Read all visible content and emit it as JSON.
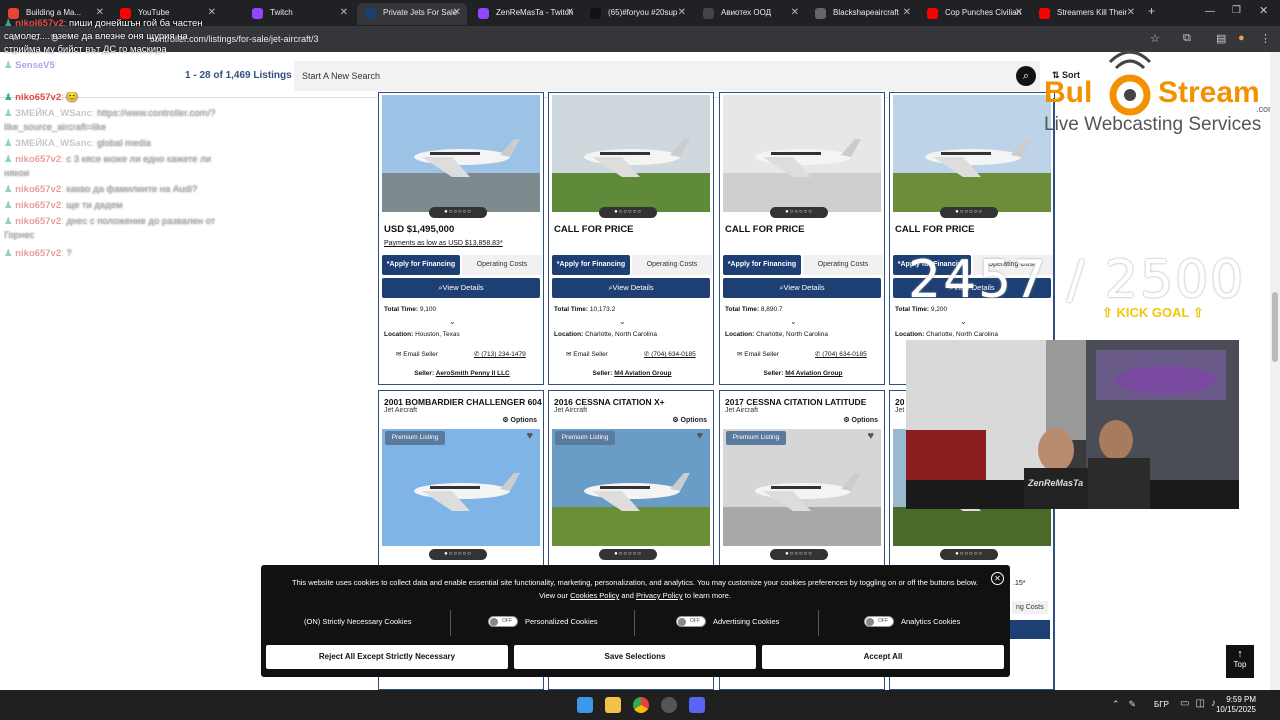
{
  "browser": {
    "tabs": [
      {
        "label": "Building a Ma...",
        "color": "#ea4335"
      },
      {
        "label": "YouTube",
        "color": "#ff0000"
      },
      {
        "label": "Twitch",
        "color": "#9146ff"
      },
      {
        "label": "Private Jets For Sale",
        "color": "#1e3f73"
      },
      {
        "label": "ZenReMasTa - Twitch",
        "color": "#9146ff"
      },
      {
        "label": "(65)#foryou #20sup",
        "color": "#111111"
      },
      {
        "label": "Авиотех ООД",
        "color": "#444444"
      },
      {
        "label": "Blackshapeaircraft",
        "color": "#666666"
      },
      {
        "label": "Cop Punches Civilian",
        "color": "#ff0000"
      },
      {
        "label": "Streamers Kill Their",
        "color": "#ff0000"
      }
    ],
    "url": "controller.com/listings/for-sale/jet-aircraft/3"
  },
  "header": {
    "listing_count": "1 - 28 of 1,469 Listings",
    "search_placeholder": "Start A New Search",
    "sort_label": "Sort"
  },
  "chat": {
    "messages": [
      {
        "user": "nikol657v2",
        "text": "пиши донейшън гой ба частен",
        "color": "#e14b4b",
        "dim": false
      },
      {
        "user": "",
        "text": "самолет.... вземе да влезне оня щурия на",
        "color": "#ffffff",
        "dim": false
      },
      {
        "user": "",
        "text": "стрийма му бийст вът ДС го маскира",
        "color": "#ffffff",
        "dim": false
      },
      {
        "user": "SenseV5",
        "text": "",
        "color": "#6a5acd",
        "dim": true
      },
      {
        "user": "niko657v2",
        "text": "😊",
        "color": "#e14b4b",
        "dim": false
      },
      {
        "user": "ЗМЕЙКА_WSanc",
        "text": "https://www.controller.com/?",
        "color": "#999999",
        "dim": true
      },
      {
        "user": "",
        "text": "like_source_aircraft=like",
        "color": "#bbbbbb",
        "dim": true
      },
      {
        "user": "ЗМЕЙКА_WSanc",
        "text": "global media",
        "color": "#999999",
        "dim": true
      },
      {
        "user": "niko657v2",
        "text": "с 3 кясе може ли едно кажете ли",
        "color": "#e14b4b",
        "dim": true
      },
      {
        "user": "",
        "text": "някои",
        "color": "#bbbbbb",
        "dim": true
      },
      {
        "user": "niko657v2",
        "text": "какво да фамилиите на Audi?",
        "color": "#e14b4b",
        "dim": true
      },
      {
        "user": "niko657v2",
        "text": "ще ти дадем",
        "color": "#e14b4b",
        "dim": true
      },
      {
        "user": "niko657v2",
        "text": "днес с положение до развален от",
        "color": "#e14b4b",
        "dim": true
      },
      {
        "user": "",
        "text": "Горнес",
        "color": "#bbbbbb",
        "dim": true
      },
      {
        "user": "niko657v2",
        "text": "?",
        "color": "#e14b4b",
        "dim": true
      }
    ]
  },
  "cards_top": [
    {
      "price": "USD $1,495,000",
      "payments": "Payments as low as USD $13,858.83*",
      "finance": "*Apply for Financing",
      "operating": "Operating Costs",
      "view": "View Details",
      "total_time_label": "Total Time:",
      "total_time": "9,100",
      "location_label": "Location:",
      "location": "Houston, Texas",
      "email": "Email Seller",
      "phone": "(713) 234-1479",
      "seller_label": "Seller:",
      "seller": "AeroSmith Penny II LLC"
    },
    {
      "price": "CALL FOR PRICE",
      "payments": "",
      "finance": "*Apply for Financing",
      "operating": "Operating Costs",
      "view": "View Details",
      "total_time_label": "Total Time:",
      "total_time": "10,173.2",
      "location_label": "Location:",
      "location": "Charlotte, North Carolina",
      "email": "Email Seller",
      "phone": "(704) 634-0185",
      "seller_label": "Seller:",
      "seller": "M4 Aviation Group"
    },
    {
      "price": "CALL FOR PRICE",
      "payments": "",
      "finance": "*Apply for Financing",
      "operating": "Operating Costs",
      "view": "View Details",
      "total_time_label": "Total Time:",
      "total_time": "8,890.7",
      "location_label": "Location:",
      "location": "Charlotte, North Carolina",
      "email": "Email Seller",
      "phone": "(704) 634-0185",
      "seller_label": "Seller:",
      "seller": "M4 Aviation Group"
    },
    {
      "price": "CALL FOR PRICE",
      "payments": "",
      "finance": "*Apply for Financing",
      "operating": "Operating Costs",
      "view": "View Details",
      "total_time_label": "Total Time:",
      "total_time": "9,200",
      "location_label": "Location:",
      "location": "Charlotte, North Carolina",
      "email": "",
      "phone": "",
      "seller_label": "",
      "seller": ""
    }
  ],
  "cards_bottom": [
    {
      "title": "2001 BOMBARDIER CHALLENGER 604",
      "category": "Jet Aircraft",
      "options": "Options",
      "badge": "Premium Listing"
    },
    {
      "title": "2016 CESSNA CITATION X+",
      "category": "Jet Aircraft",
      "options": "Options",
      "badge": "Premium Listing"
    },
    {
      "title": "2017 CESSNA CITATION LATITUDE",
      "category": "Jet Aircraft",
      "options": "Options",
      "badge": "Premium Listing"
    },
    {
      "title": "20",
      "category": "Jet",
      "options": "",
      "badge": ""
    }
  ],
  "overlay": {
    "logo_top": "Bul",
    "logo_right": "Stream",
    "logo_com": ".com",
    "logo_sub": "Live Webcasting Services",
    "goal": "2457 / 2500",
    "kick": "KICK GOAL",
    "cam_shirt": "ZenReMasTa"
  },
  "cookie": {
    "text": "This website uses cookies to collect data and enable essential site functionality, marketing, personalization, and analytics. You may customize your cookies preferences by toggling on or off the buttons below.",
    "text2_pre": "View our",
    "policy": "Cookies Policy",
    "and": "and",
    "privacy": "Privacy Policy",
    "text2_post": "to learn more.",
    "strict": "(ON) Strictly Necessary Cookies",
    "personalized": "Personalized Cookies",
    "advertising": "Advertising Cookies",
    "analytics": "Analytics Cookies",
    "off": "OFF",
    "reject": "Reject All Except Strictly Necessary",
    "save": "Save Selections",
    "accept": "Accept All"
  },
  "page_peek": {
    "price_tail": ".15*",
    "op_costs": "ng Costs"
  },
  "top_button": "Top",
  "taskbar": {
    "lang": "БГР",
    "time": "9:59 PM",
    "date": "10/15/2025"
  }
}
